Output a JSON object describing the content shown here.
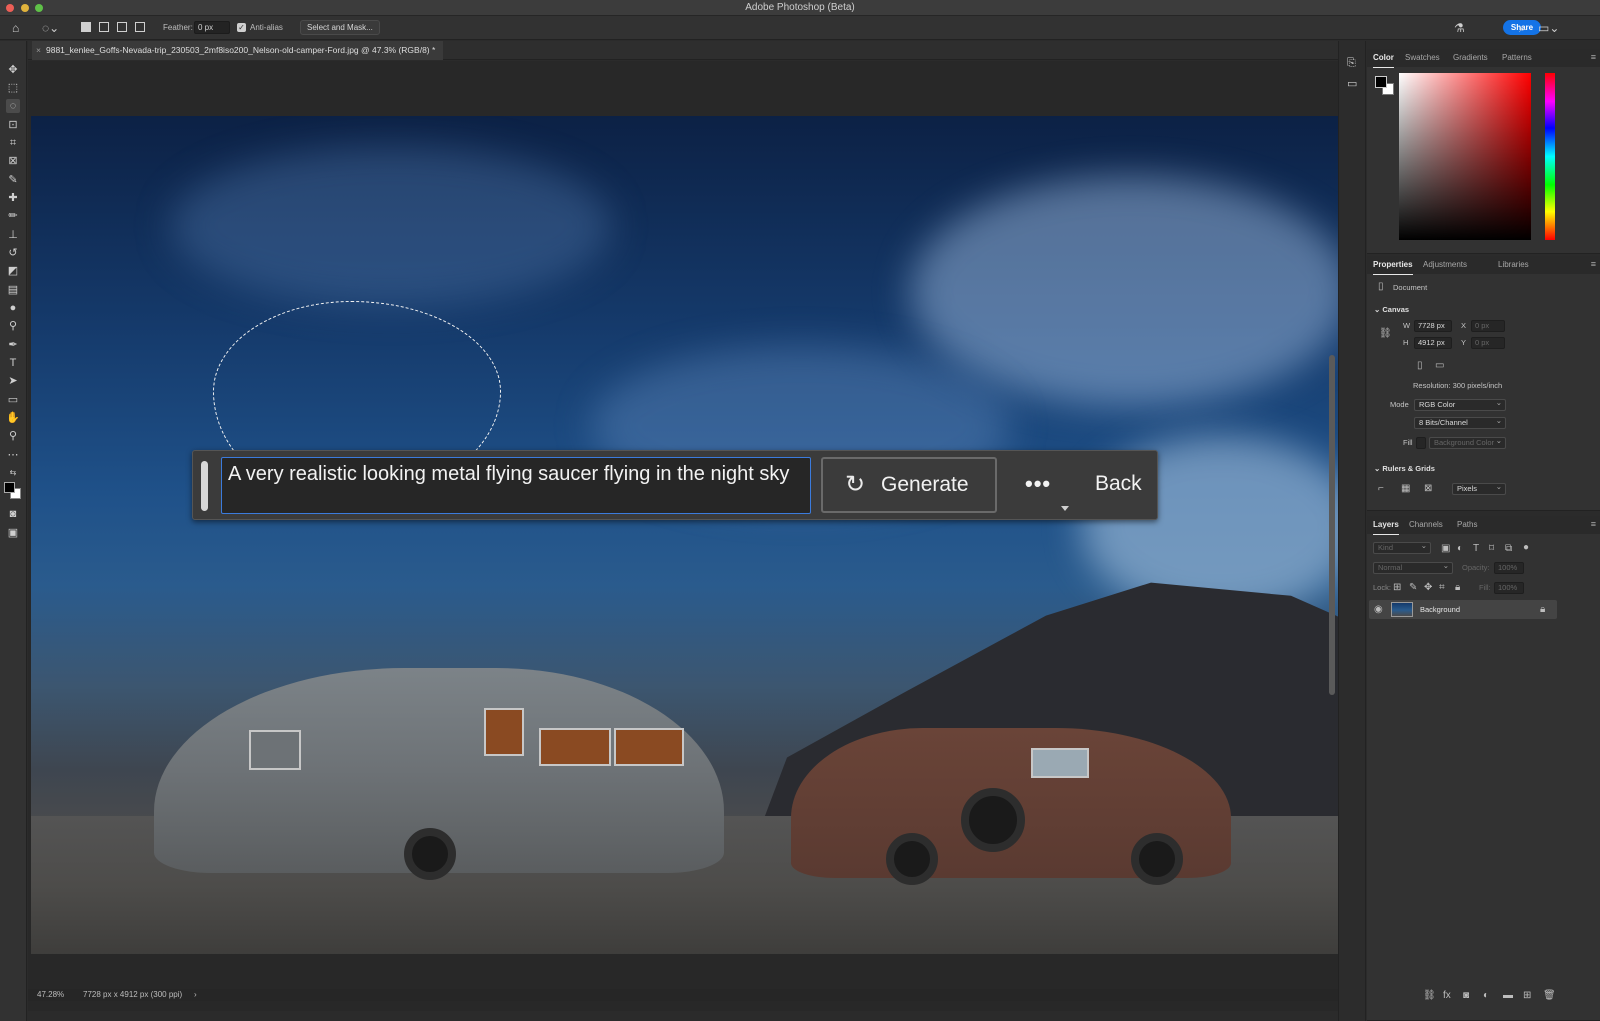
{
  "window": {
    "title": "Adobe Photoshop (Beta)"
  },
  "options_bar": {
    "feather_label": "Feather:",
    "feather_value": "0 px",
    "anti_alias_label": "Anti-alias",
    "anti_alias_checked": true,
    "select_and_mask_label": "Select and Mask...",
    "share_label": "Share"
  },
  "document": {
    "tab_title": "9881_kenlee_Goffs-Nevada-trip_230503_2mf8iso200_Nelson-old-camper-Ford.jpg @ 47.3% (RGB/8) *",
    "close_glyph": "×"
  },
  "generative_fill": {
    "prompt": "A very realistic looking metal flying saucer flying in the night sky",
    "generate_label": "Generate",
    "more_label": "•••",
    "back_label": "Back"
  },
  "status_bar": {
    "zoom": "47.28%",
    "doc_info": "7728 px x 4912 px (300 ppi)",
    "arrow": "›"
  },
  "color_panel": {
    "tabs": [
      "Color",
      "Swatches",
      "Gradients",
      "Patterns"
    ],
    "active_tab": "Color",
    "foreground": "#000000",
    "background": "#ffffff"
  },
  "properties_panel": {
    "tabs": [
      "Properties",
      "Adjustments",
      "Libraries"
    ],
    "active_tab": "Properties",
    "type_label": "Document",
    "canvas_section": "Canvas",
    "w_label": "W",
    "w_value": "7728 px",
    "h_label": "H",
    "h_value": "4912 px",
    "x_label": "X",
    "x_value": "0 px",
    "y_label": "Y",
    "y_value": "0 px",
    "resolution": "Resolution: 300 pixels/inch",
    "mode_label": "Mode",
    "mode_value": "RGB Color",
    "depth_value": "8 Bits/Channel",
    "fill_label": "Fill",
    "fill_value": "Background Color",
    "rulers_section": "Rulers & Grids",
    "units_value": "Pixels"
  },
  "layers_panel": {
    "tabs": [
      "Layers",
      "Channels",
      "Paths"
    ],
    "active_tab": "Layers",
    "kind_placeholder": "Kind",
    "blend_mode": "Normal",
    "opacity_label": "Opacity:",
    "opacity_value": "100%",
    "lock_label": "Lock:",
    "fill_label": "Fill:",
    "fill_value": "100%",
    "layers": [
      {
        "name": "Background",
        "visible": true,
        "locked": true
      }
    ]
  },
  "colors": {
    "accent": "#1473e6",
    "focus_border": "#3b7bdc",
    "panel_bg": "#323232",
    "canvas_bg": "#282828"
  }
}
